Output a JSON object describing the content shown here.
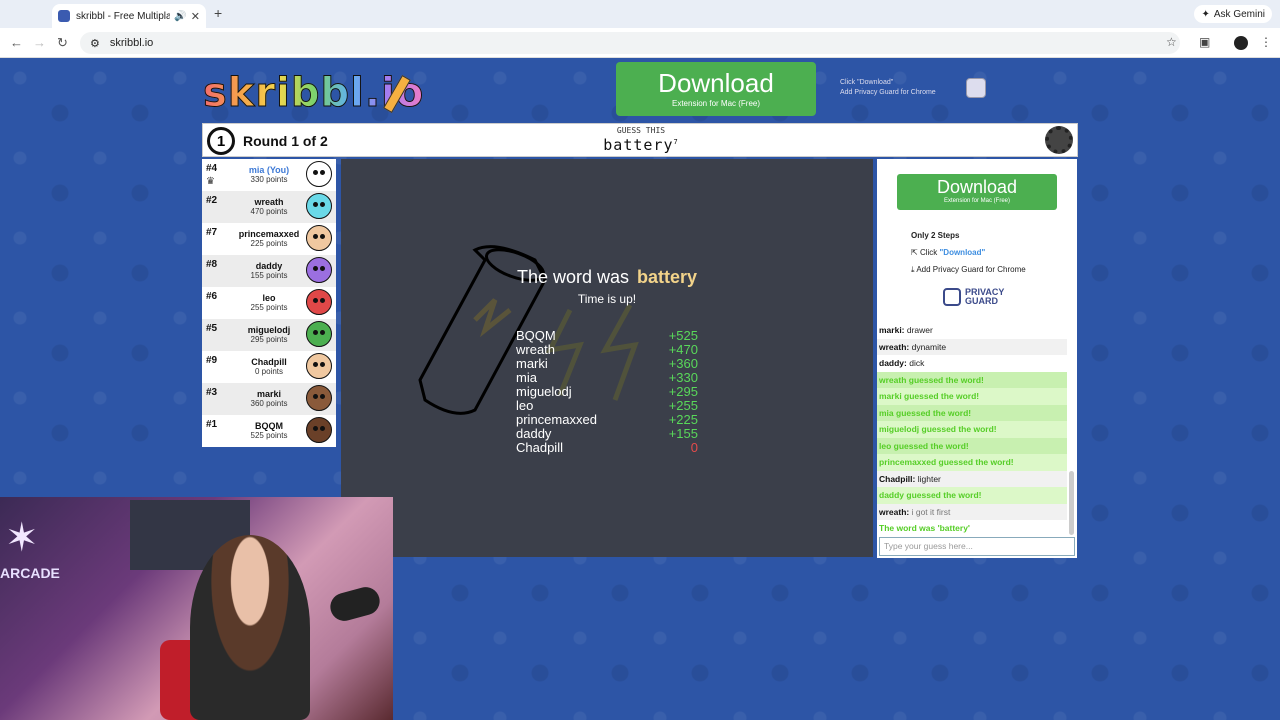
{
  "browser": {
    "tab_title": "skribbl - Free Multiplayer",
    "url": "skribbl.io",
    "ask_gemini": "Ask Gemini"
  },
  "header": {
    "logo": "skribbl.io",
    "download_big": "Download",
    "download_small": "Extension for Mac (Free)",
    "steps_click": "Click \"Download\"",
    "steps_add": "Add Privacy Guard for Chrome"
  },
  "topbar": {
    "round_number": "1",
    "round_text": "Round 1 of 2",
    "guess_label": "GUESS THIS",
    "word": "battery",
    "word_length": "7"
  },
  "players": [
    {
      "rank": "#4",
      "name": "mia (You)",
      "points": "330 points",
      "me": true,
      "color": "#ffffff"
    },
    {
      "rank": "#2",
      "name": "wreath",
      "points": "470 points",
      "color": "#6ad9e8"
    },
    {
      "rank": "#7",
      "name": "princemaxxed",
      "points": "225 points",
      "color": "#f0c8a0"
    },
    {
      "rank": "#8",
      "name": "daddy",
      "points": "155 points",
      "color": "#9b6fe0"
    },
    {
      "rank": "#6",
      "name": "leo",
      "points": "255 points",
      "color": "#e04848"
    },
    {
      "rank": "#5",
      "name": "miguelodj",
      "points": "295 points",
      "color": "#4caf50"
    },
    {
      "rank": "#9",
      "name": "Chadpill",
      "points": "0 points",
      "color": "#f0c8a0"
    },
    {
      "rank": "#3",
      "name": "marki",
      "points": "360 points",
      "color": "#8a5a3a"
    },
    {
      "rank": "#1",
      "name": "BQQM",
      "points": "525 points",
      "color": "#6a4028"
    }
  ],
  "result": {
    "word_was": "The word was",
    "word": "battery",
    "time_up": "Time is up!",
    "scores": [
      {
        "name": "BQQM",
        "pts": "+525"
      },
      {
        "name": "wreath",
        "pts": "+470"
      },
      {
        "name": "marki",
        "pts": "+360"
      },
      {
        "name": "mia",
        "pts": "+330"
      },
      {
        "name": "miguelodj",
        "pts": "+295"
      },
      {
        "name": "leo",
        "pts": "+255"
      },
      {
        "name": "princemaxxed",
        "pts": "+225"
      },
      {
        "name": "daddy",
        "pts": "+155"
      },
      {
        "name": "Chadpill",
        "pts": "0"
      }
    ]
  },
  "sidebar": {
    "download_big": "Download",
    "download_small": "Extension for Mac (Free)",
    "only_steps": "Only 2 Steps",
    "click": "Click ",
    "download_link": "\"Download\"",
    "add_pg": "Add Privacy Guard for Chrome",
    "pg_line1": "PRIVACY",
    "pg_line2": "GUARD"
  },
  "chat": [
    {
      "name": "marki:",
      "text": " drawer"
    },
    {
      "name": "wreath:",
      "text": " dynamite"
    },
    {
      "name": "daddy:",
      "text": " dick"
    },
    {
      "ok": "wreath guessed the word!"
    },
    {
      "ok": "marki guessed the word!"
    },
    {
      "ok": "mia guessed the word!"
    },
    {
      "ok": "miguelodj guessed the word!"
    },
    {
      "ok": "leo guessed the word!"
    },
    {
      "ok": "princemaxxed guessed the word!"
    },
    {
      "name": "Chadpill:",
      "text": " lighter"
    },
    {
      "ok": "daddy guessed the word!"
    },
    {
      "name": "wreath:",
      "text": " i got it first",
      "faded": true
    },
    {
      "end": "The word was 'battery'"
    }
  ],
  "chat_input_placeholder": "Type your guess here...",
  "webcam": {
    "sign": "ARCADE"
  }
}
